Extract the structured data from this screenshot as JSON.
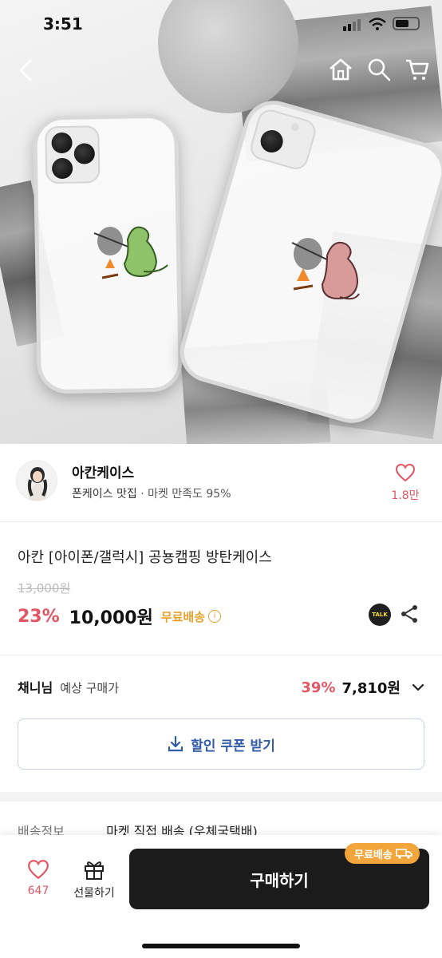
{
  "status_bar": {
    "time": "3:51"
  },
  "hero": {
    "alt": "product image"
  },
  "store": {
    "name": "아칸케이스",
    "category": "폰케이스 맛집",
    "satisfaction": "· 마켓 만족도 95%",
    "like_count": "1.8만"
  },
  "product": {
    "title": "아칸 [아이폰/갤럭시] 공뇽캠핑 방탄케이스",
    "original_price": "13,000원",
    "discount": "23%",
    "price": "10,000원",
    "shipping_badge": "무료배송",
    "talk_label": "TALK"
  },
  "predicted": {
    "user_name": "채니님",
    "label": "예상 구매가",
    "discount": "39%",
    "price": "7,810원"
  },
  "coupon": {
    "label": "할인 쿠폰 받기"
  },
  "shipping": {
    "label": "배송정보",
    "value": "마켓 직접 배송 (우체국택배)"
  },
  "bottom_bar": {
    "like_count": "647",
    "gift_label": "선물하기",
    "buy_label": "구매하기",
    "free_badge": "무료배송"
  },
  "colors": {
    "accent_red": "#e25563",
    "free_orange": "#e6a22f",
    "coupon_blue": "#2f5ba8",
    "buy_black": "#1b1b1b"
  }
}
